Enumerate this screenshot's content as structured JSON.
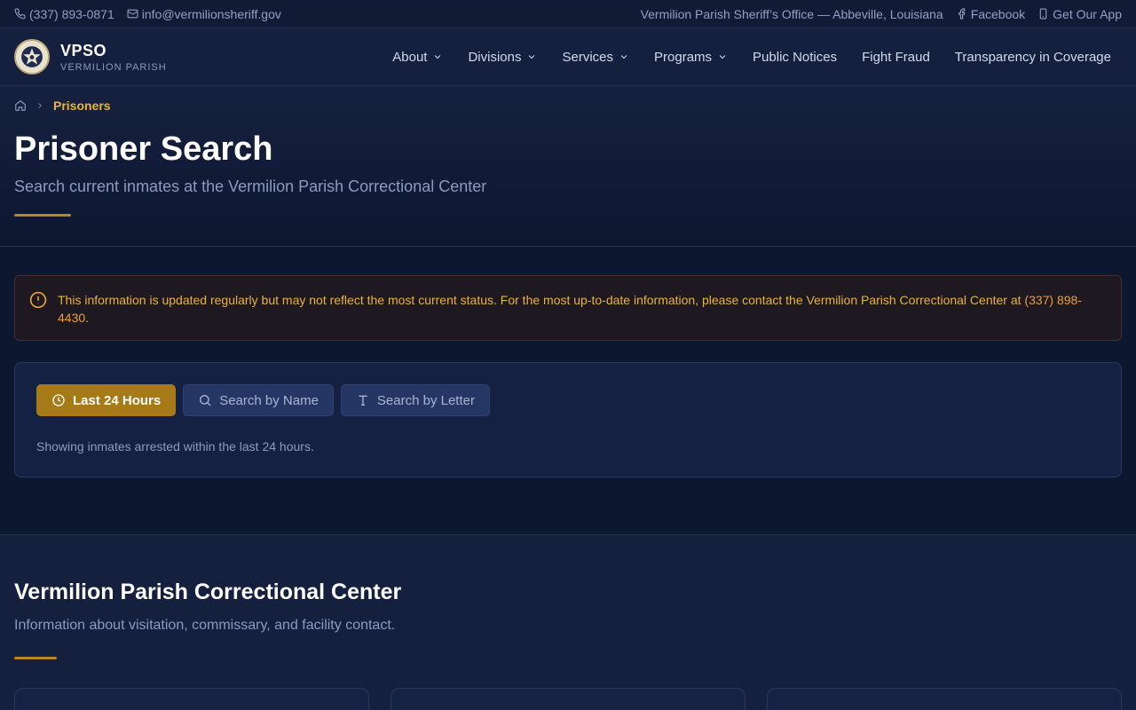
{
  "topbar": {
    "phone": "(337) 893-0871",
    "email": "info@vermilionsheriff.gov",
    "office": "Vermilion Parish Sheriff’s Office — Abbeville, Louisiana",
    "facebook": "Facebook",
    "app": "Get Our App"
  },
  "brand": {
    "name": "VPSO",
    "subtitle": "VERMILION PARISH"
  },
  "nav": {
    "items": [
      {
        "label": "About",
        "dropdown": true
      },
      {
        "label": "Divisions",
        "dropdown": true
      },
      {
        "label": "Services",
        "dropdown": true
      },
      {
        "label": "Programs",
        "dropdown": true
      },
      {
        "label": "Public Notices",
        "dropdown": false
      },
      {
        "label": "Fight Fraud",
        "dropdown": false
      },
      {
        "label": "Transparency in Coverage",
        "dropdown": false
      }
    ]
  },
  "breadcrumb": {
    "current": "Prisoners"
  },
  "hero": {
    "title": "Prisoner Search",
    "subtitle": "Search current inmates at the Vermilion Parish Correctional Center"
  },
  "alert": {
    "text": "This information is updated regularly but may not reflect the most current status. For the most up-to-date information, please contact the Vermilion Parish Correctional Center at ",
    "phone": "(337) 898-4430",
    "suffix": "."
  },
  "search": {
    "tabs": [
      {
        "label": "Last 24 Hours",
        "icon": "clock-icon",
        "active": true
      },
      {
        "label": "Search by Name",
        "icon": "search-icon",
        "active": false
      },
      {
        "label": "Search by Letter",
        "icon": "text-icon",
        "active": false
      }
    ],
    "note": "Showing inmates arrested within the last 24 hours."
  },
  "facility": {
    "title": "Vermilion Parish Correctional Center",
    "description": "Information about visitation, commissary, and facility contact."
  },
  "colors": {
    "accent": "#a57a17",
    "accent_text": "#e8b43a",
    "background": "#0f172e"
  }
}
